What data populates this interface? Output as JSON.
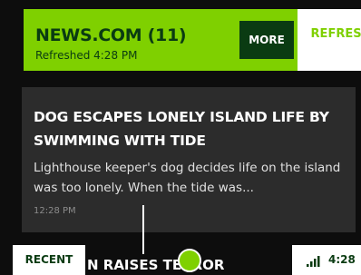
{
  "header": {
    "title": "NEWS.COM (11)",
    "refresh_status": "Refreshed 4:28 PM",
    "more_label": "MORE",
    "refresh_label": "REFRESH"
  },
  "article": {
    "headline": "DOG ESCAPES LONELY ISLAND LIFE BY SWIMMING WITH TIDE",
    "summary": "Lighthouse keeper's dog decides life on the island was too lonely. When the tide was...",
    "time": "12:28 PM"
  },
  "next_article": {
    "headline_partial": "N RAISES TERROR"
  },
  "bottom": {
    "recent_label": "RECENT",
    "time": "4:28",
    "signal_icon": "signal-icon"
  },
  "colors": {
    "accent": "#7fd000",
    "dark_green": "#0a3b12",
    "card": "#2c2c2c",
    "background": "#0d0d0d"
  }
}
